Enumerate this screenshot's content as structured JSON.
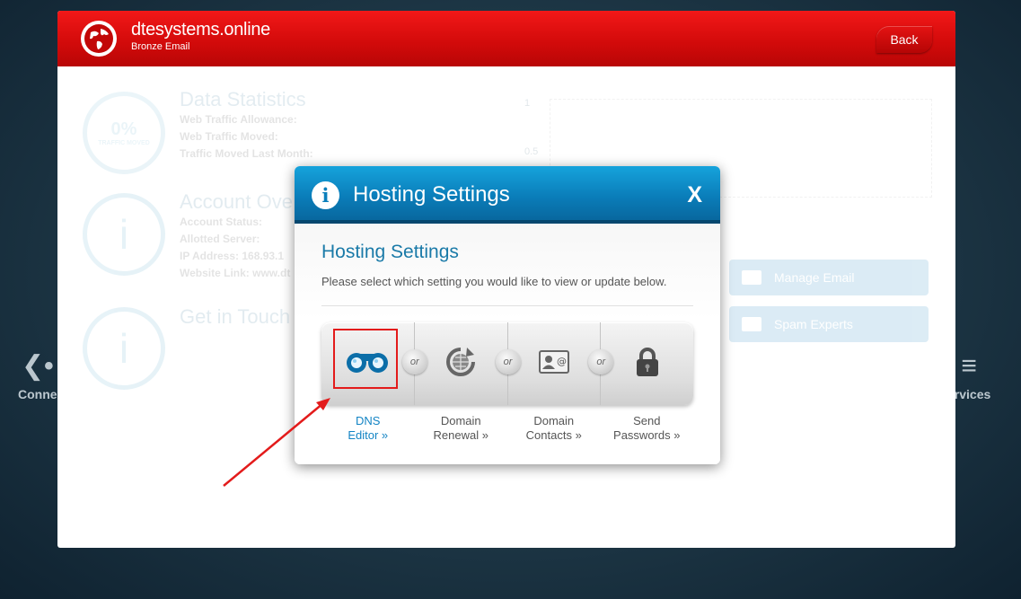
{
  "background": {
    "left_item": "Conne",
    "right_item": "ervices"
  },
  "header": {
    "site_title": "dtesystems.online",
    "site_subtitle": "Bronze Email",
    "back_label": "Back"
  },
  "faded_content": {
    "ring_percent": "0%",
    "ring_percent_caption": "TRAFFIC MOVED",
    "data_statistics": {
      "title": "Data Statistics",
      "lines": [
        "Web Traffic Allowance:",
        "Web Traffic Moved:",
        "Traffic Moved Last Month:"
      ]
    },
    "account_overview": {
      "title": "Account Ove",
      "lines": [
        "Account Status:",
        "Allotted Server:",
        "IP Address: 168.93.1",
        "Website Link: www.dt"
      ]
    },
    "get_in_touch": {
      "title": "Get in Touch"
    },
    "graph_ticks": [
      "1",
      "0.5"
    ],
    "manage_email_label": "Manage Email",
    "spam_experts_label": "Spam Experts"
  },
  "modal": {
    "header_title": "Hosting Settings",
    "close_label": "X",
    "body_title": "Hosting Settings",
    "description": "Please select which setting you would like to view or update below.",
    "or_label": "or",
    "options": [
      {
        "line1": "DNS",
        "line2": "Editor »",
        "icon": "binoculars-icon"
      },
      {
        "line1": "Domain",
        "line2": "Renewal »",
        "icon": "globe-refresh-icon"
      },
      {
        "line1": "Domain",
        "line2": "Contacts »",
        "icon": "contact-card-icon"
      },
      {
        "line1": "Send",
        "line2": "Passwords »",
        "icon": "padlock-icon"
      }
    ]
  },
  "colors": {
    "header_red": "#d10a0a",
    "modal_blue": "#0a7cb8",
    "link_blue": "#1384c4",
    "annotation_red": "#e31b1b"
  }
}
